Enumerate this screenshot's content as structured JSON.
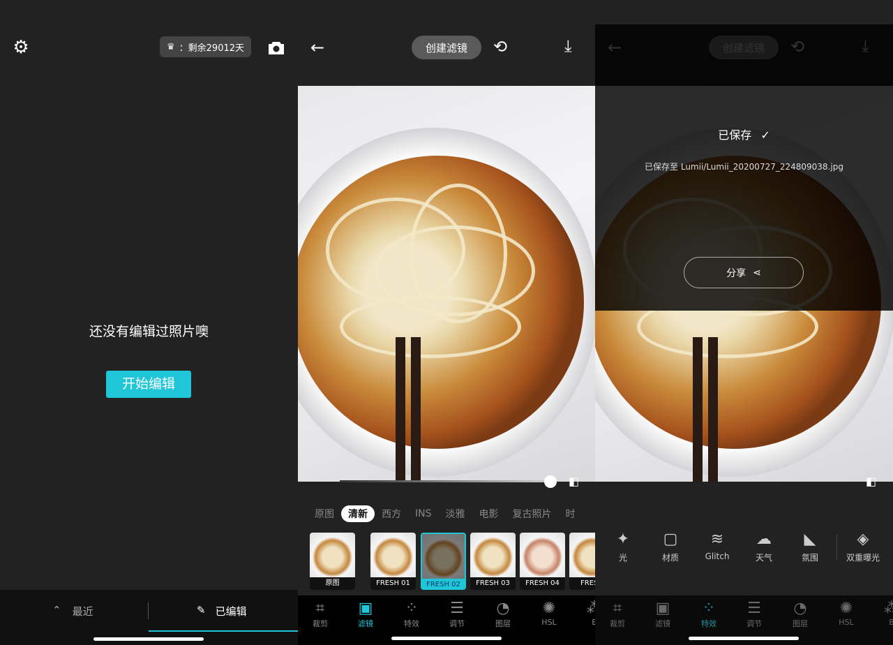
{
  "accent": "#1fc6d8",
  "home": {
    "settings_icon": "gear-icon",
    "vip_badge": "：剩余29012天",
    "camera_icon": "camera-icon",
    "empty_text": "还没有编辑过照片噢",
    "start_button": "开始编辑",
    "tabs": [
      {
        "label": "最近",
        "icon": "chevron-up-icon"
      },
      {
        "label": "已编辑",
        "icon": "pencil-icon",
        "active": true
      }
    ]
  },
  "editor": {
    "create_filter": "创建滤镜",
    "categories": [
      "原图",
      "清新",
      "西方",
      "INS",
      "淡雅",
      "电影",
      "复古照片",
      "时"
    ],
    "active_category": "清新",
    "filters": [
      "原图",
      "FRESH 01",
      "FRESH 02",
      "FRESH 03",
      "FRESH 04",
      "FRESH"
    ],
    "selected_filter": "FRESH 02",
    "strength_percent": 100,
    "nav": [
      {
        "label": "裁剪",
        "icon": "crop-icon"
      },
      {
        "label": "滤镜",
        "icon": "filter-icon"
      },
      {
        "label": "特效",
        "icon": "effects-icon"
      },
      {
        "label": "调节",
        "icon": "sliders-icon"
      },
      {
        "label": "图层",
        "icon": "sticker-icon"
      },
      {
        "label": "HSL",
        "icon": "hsl-icon"
      },
      {
        "label": "B",
        "icon": "bokeh-icon"
      }
    ],
    "active_nav": "滤镜"
  },
  "saved": {
    "create_filter": "创建滤镜",
    "title": "已保存",
    "path": "已保存至 Lumii/Lumii_20200727_224809038.jpg",
    "share": "分享",
    "effects": [
      {
        "label": "光",
        "icon": "sparkle-icon"
      },
      {
        "label": "材质",
        "icon": "texture-icon"
      },
      {
        "label": "Glitch",
        "icon": "glitch-icon"
      },
      {
        "label": "天气",
        "icon": "weather-icon"
      },
      {
        "label": "氛围",
        "icon": "atmosphere-icon"
      },
      {
        "label": "双重曝光",
        "icon": "layers-icon"
      }
    ],
    "active_nav": "特效"
  }
}
